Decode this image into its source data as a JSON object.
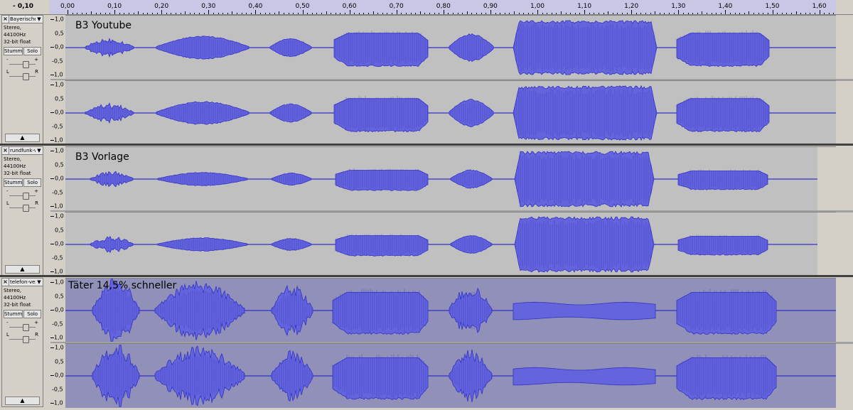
{
  "ruler": {
    "start_label": "- 0,10",
    "labels": [
      "0,00",
      "0,10",
      "0,20",
      "0,30",
      "0,40",
      "0,50",
      "0,60",
      "0,70",
      "0,80",
      "0,90",
      "1,00",
      "1,10",
      "1,20",
      "1,30",
      "1,40",
      "1,50",
      "1,60"
    ]
  },
  "tracks": [
    {
      "name": "Bayerische",
      "info1": "Stereo, 44100Hz",
      "info2": "32-bit float",
      "mute_label": "Stumm",
      "solo_label": "Solo",
      "gain_minus": "-",
      "gain_plus": "+",
      "pan_left": "L",
      "pan_right": "R",
      "collapse": "▲",
      "label": "B3 Youtube",
      "scale": [
        "1,0",
        "0,5",
        "0,0",
        "-0,5",
        "-1,0"
      ],
      "selected": false
    },
    {
      "name": "rundfunk-v",
      "info1": "Stereo, 44100Hz",
      "info2": "32-bit float",
      "mute_label": "Stumm",
      "solo_label": "Solo",
      "gain_minus": "-",
      "gain_plus": "+",
      "pan_left": "L",
      "pan_right": "R",
      "collapse": "▲",
      "label": "B3 Vorlage",
      "scale": [
        "1,0",
        "0,5",
        "0,0",
        "-0,5",
        "-1,0"
      ],
      "selected": false
    },
    {
      "name": "telefon-ver",
      "info1": "Stereo, 44100Hz",
      "info2": "32-bit float",
      "mute_label": "Stumm",
      "solo_label": "Solo",
      "gain_minus": "-",
      "gain_plus": "+",
      "pan_left": "L",
      "pan_right": "R",
      "collapse": "▲",
      "label": "Täter 14,5% schneller",
      "scale": [
        "1,0",
        "0,5",
        "0,0",
        "-0,5",
        "-1,0"
      ],
      "selected": true
    }
  ],
  "colors": {
    "waveform": "#3232c8",
    "waveform_fill": "#6464dc",
    "track_bg": "#c0c0c0",
    "track_bg_selected": "#9090b8",
    "track_bg_empty": "#d4d0c8"
  },
  "icons": {
    "close": "close-icon",
    "menu": "dropdown-arrow-icon",
    "collapse": "collapse-arrow-icon"
  }
}
